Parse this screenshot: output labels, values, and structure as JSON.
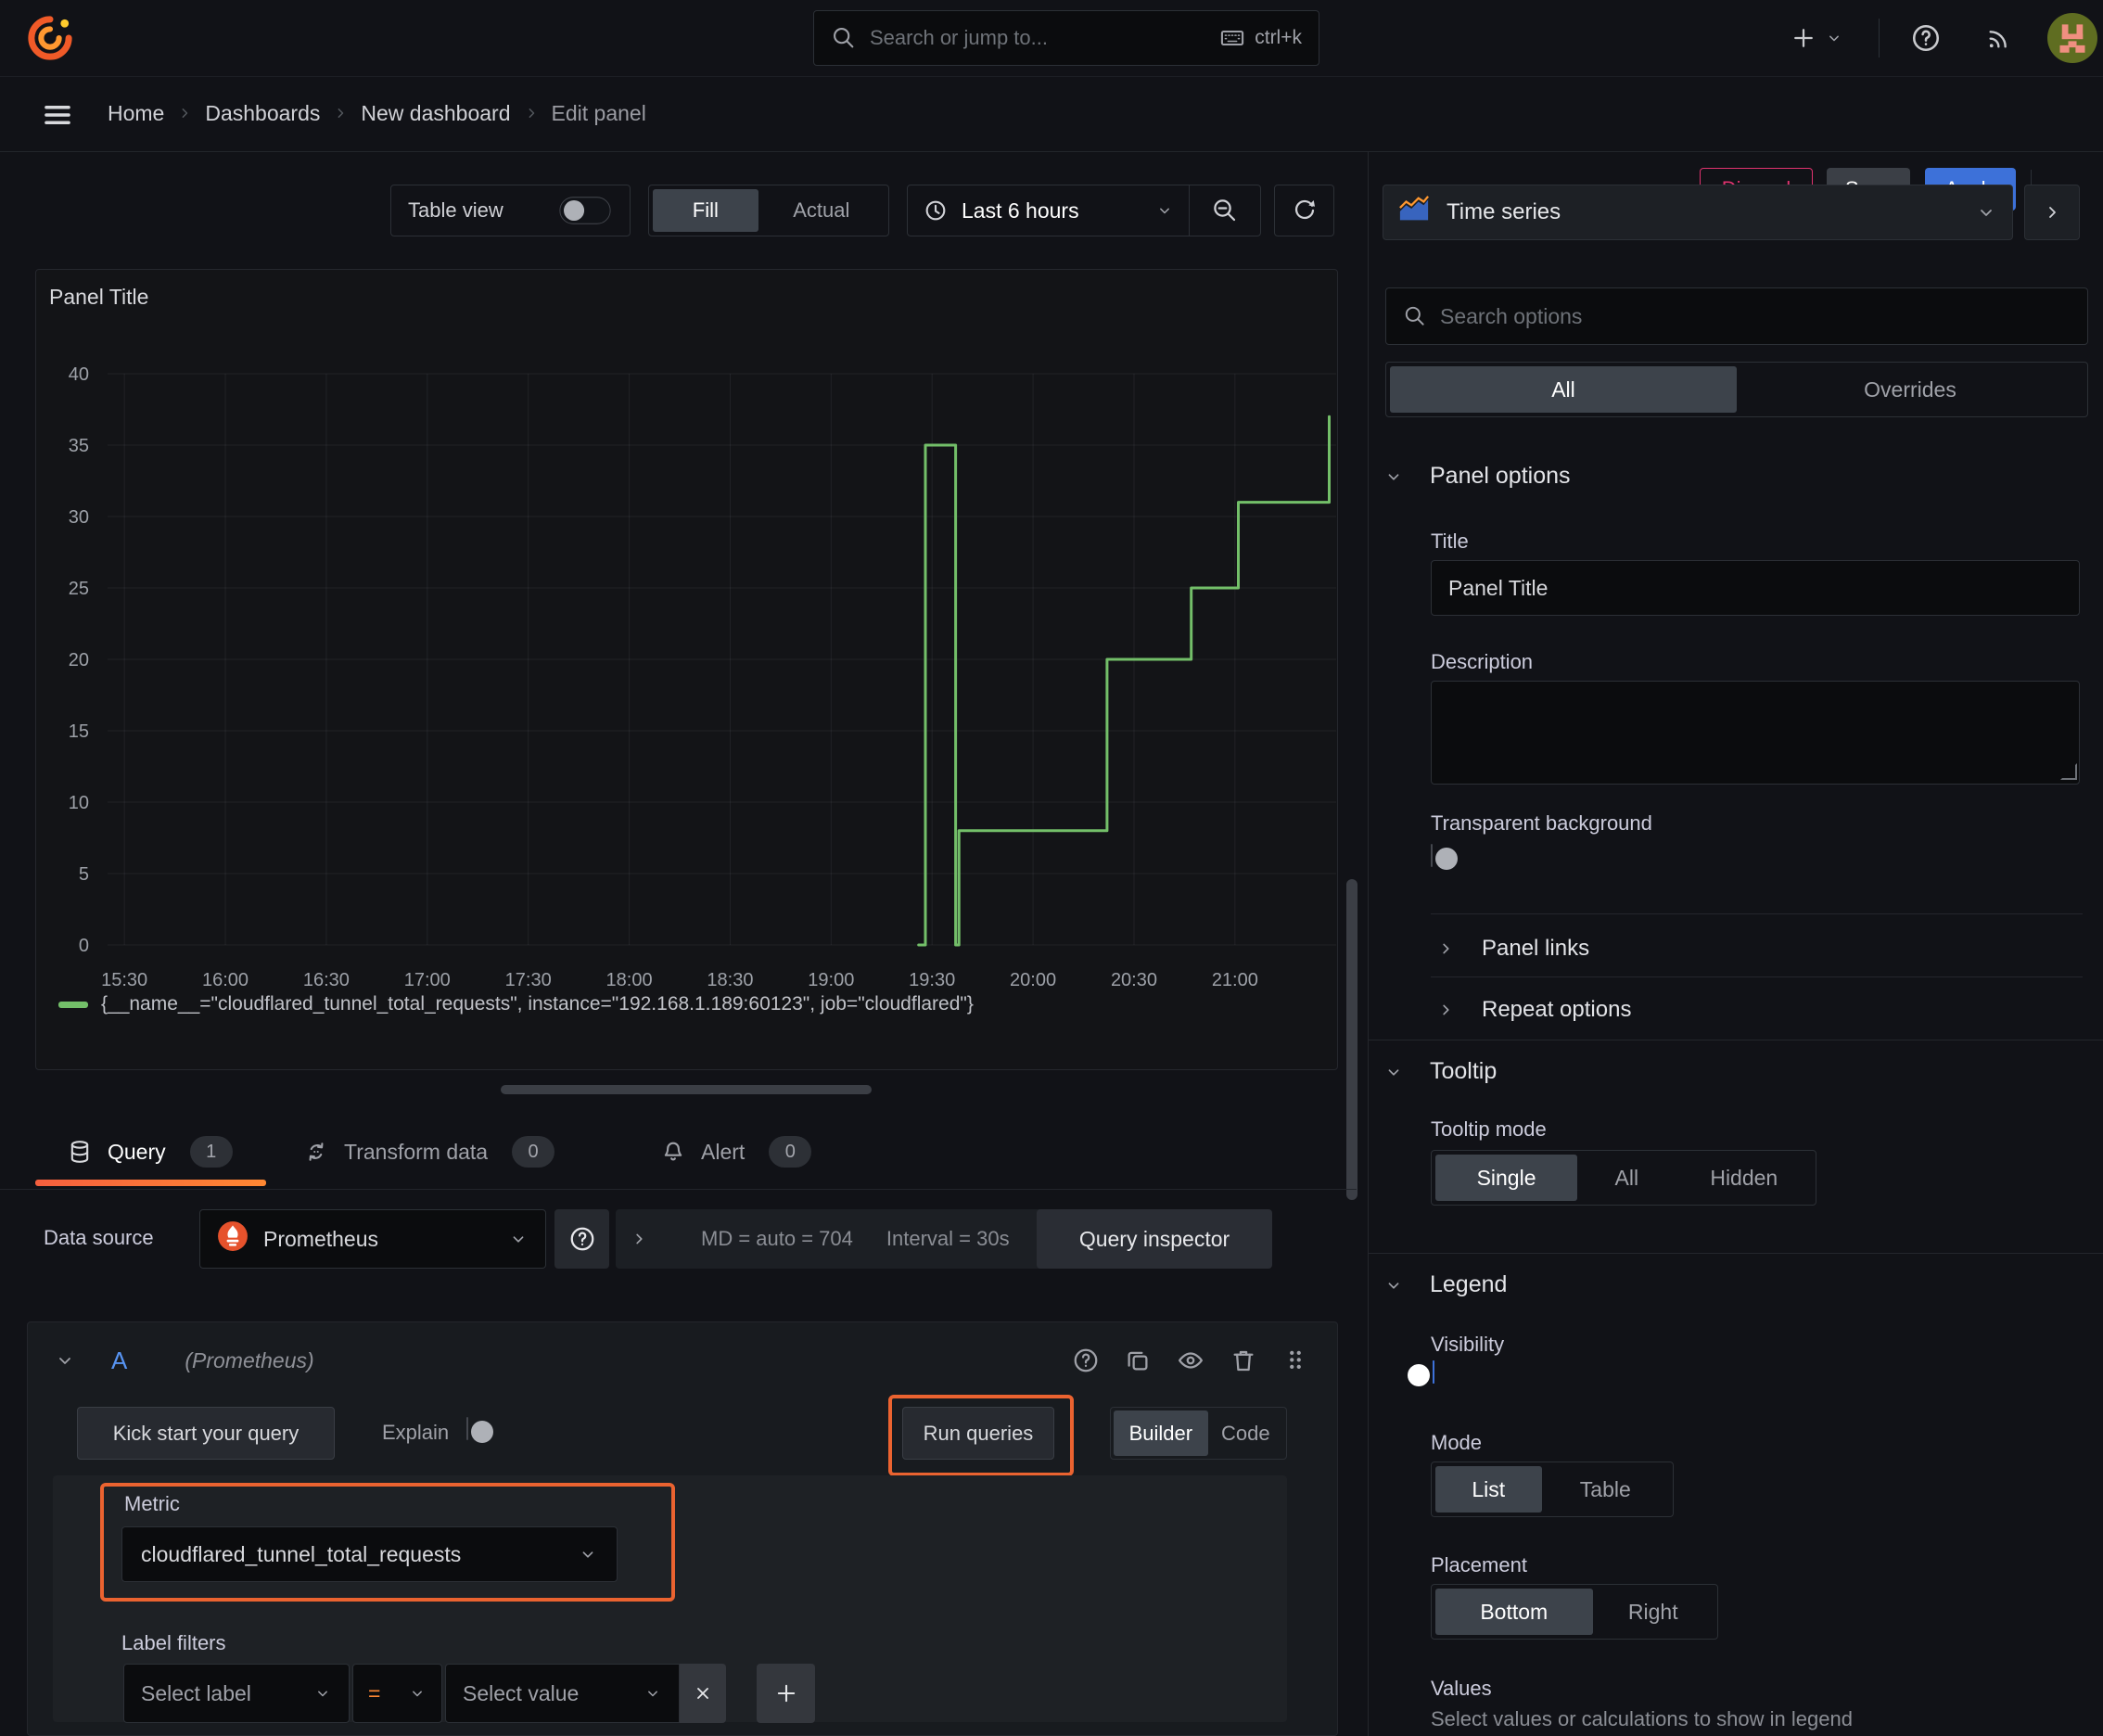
{
  "topbar": {
    "search_placeholder": "Search or jump to...",
    "search_shortcut": "ctrl+k"
  },
  "breadcrumb": {
    "items": [
      {
        "label": "Home"
      },
      {
        "label": "Dashboards"
      },
      {
        "label": "New dashboard"
      },
      {
        "label": "Edit panel"
      }
    ]
  },
  "header_actions": {
    "discard": "Discard",
    "save": "Save",
    "apply": "Apply"
  },
  "panel_toolbar": {
    "table_view_label": "Table view",
    "table_view_on": false,
    "fill_label": "Fill",
    "actual_label": "Actual",
    "fill_selected": "Fill",
    "time_range_label": "Last 6 hours"
  },
  "viz_picker": {
    "name": "Time series"
  },
  "panel": {
    "title": "Panel Title"
  },
  "chart_data": {
    "type": "line",
    "line_interpolation": "step-after",
    "title": "Panel Title",
    "xlabel": "",
    "ylabel": "",
    "ylim": [
      0,
      40
    ],
    "yticks": [
      0,
      5,
      10,
      15,
      20,
      25,
      30,
      35,
      40
    ],
    "x_domain_minutes": [
      925,
      1292
    ],
    "xticks": [
      {
        "min": 930,
        "label": "15:30"
      },
      {
        "min": 960,
        "label": "16:00"
      },
      {
        "min": 990,
        "label": "16:30"
      },
      {
        "min": 1020,
        "label": "17:00"
      },
      {
        "min": 1050,
        "label": "17:30"
      },
      {
        "min": 1080,
        "label": "18:00"
      },
      {
        "min": 1110,
        "label": "18:30"
      },
      {
        "min": 1140,
        "label": "19:00"
      },
      {
        "min": 1170,
        "label": "19:30"
      },
      {
        "min": 1200,
        "label": "20:00"
      },
      {
        "min": 1230,
        "label": "20:30"
      },
      {
        "min": 1260,
        "label": "21:00"
      }
    ],
    "grid": true,
    "legend_position": "bottom",
    "series": [
      {
        "name": "{__name__=\"cloudflared_tunnel_total_requests\", instance=\"192.168.1.189:60123\", job=\"cloudflared\"}",
        "color": "#73bf69",
        "points_min_value": [
          [
            1166,
            0
          ],
          [
            1168,
            0
          ],
          [
            1168,
            35
          ],
          [
            1177,
            35
          ],
          [
            1177,
            0
          ],
          [
            1178,
            0
          ],
          [
            1178,
            8
          ],
          [
            1222,
            8
          ],
          [
            1222,
            20
          ],
          [
            1247,
            20
          ],
          [
            1247,
            25
          ],
          [
            1261,
            25
          ],
          [
            1261,
            31
          ],
          [
            1288,
            31
          ],
          [
            1288,
            37
          ]
        ]
      }
    ]
  },
  "query_tabs": [
    {
      "label": "Query",
      "count": "1"
    },
    {
      "label": "Transform data",
      "count": "0"
    },
    {
      "label": "Alert",
      "count": "0"
    }
  ],
  "datasource_row": {
    "label": "Data source",
    "name": "Prometheus",
    "md_stat": "MD = auto = 704",
    "interval_stat": "Interval = 30s",
    "inspector_label": "Query inspector"
  },
  "query_editor": {
    "ref_id": "A",
    "ds_hint": "(Prometheus)",
    "kick_start": "Kick start your query",
    "explain_label": "Explain",
    "explain_on": false,
    "run_queries": "Run queries",
    "builder": "Builder",
    "code": "Code",
    "mode_selected": "Builder",
    "metric_label": "Metric",
    "metric_value": "cloudflared_tunnel_total_requests",
    "label_filters": "Label filters",
    "select_label_placeholder": "Select label",
    "operator": "=",
    "select_value_placeholder": "Select value",
    "remove_filter": "x",
    "add_filter": "+"
  },
  "options_pane": {
    "search_placeholder": "Search options",
    "tab_all": "All",
    "tab_overrides": "Overrides",
    "tab_selected": "All",
    "panel_options": {
      "heading": "Panel options",
      "title_label": "Title",
      "title_value": "Panel Title",
      "description_label": "Description",
      "description_value": "",
      "transparent_label": "Transparent background",
      "transparent_on": false
    },
    "panel_links": "Panel links",
    "repeat_options": "Repeat options",
    "tooltip": {
      "heading": "Tooltip",
      "mode_label": "Tooltip mode",
      "single": "Single",
      "all": "All",
      "hidden": "Hidden",
      "selected": "Single"
    },
    "legend": {
      "heading": "Legend",
      "visibility_label": "Visibility",
      "visibility_on": true,
      "mode_label": "Mode",
      "list": "List",
      "table": "Table",
      "mode_selected": "List",
      "placement_label": "Placement",
      "bottom": "Bottom",
      "right": "Right",
      "placement_selected": "Bottom",
      "values_label": "Values",
      "values_hint": "Select values or calculations to show in legend"
    }
  },
  "colors": {
    "accent_orange": "#eb6330",
    "series_green": "#73bf69",
    "blue_primary": "#3d71d9",
    "danger_pink": "#e0336f",
    "toggle_blue": "#3871dc"
  }
}
